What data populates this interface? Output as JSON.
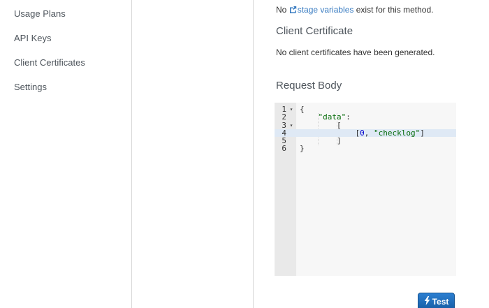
{
  "sidebar": {
    "items": [
      {
        "label": "Usage Plans"
      },
      {
        "label": "API Keys"
      },
      {
        "label": "Client Certificates"
      },
      {
        "label": "Settings"
      }
    ]
  },
  "content": {
    "stage_variables_note": {
      "prefix": "No ",
      "link_text": "stage variables",
      "suffix": " exist for this method.",
      "link_icon": "external-link-icon"
    },
    "client_certificate": {
      "heading": "Client Certificate",
      "empty_text": "No client certificates have been generated."
    },
    "request_body": {
      "heading": "Request Body"
    },
    "editor": {
      "active_line": 4,
      "lines": [
        {
          "number": 1,
          "fold": true,
          "segments": [
            {
              "t": "{",
              "c": "punct"
            }
          ]
        },
        {
          "number": 2,
          "fold": false,
          "segments": [
            {
              "t": "    ",
              "c": "punct"
            },
            {
              "t": "\"data\"",
              "c": "string"
            },
            {
              "t": ":",
              "c": "punct"
            }
          ]
        },
        {
          "number": 3,
          "fold": true,
          "segments": [
            {
              "t": "        ",
              "c": "punct"
            },
            {
              "t": "[",
              "c": "punct"
            }
          ]
        },
        {
          "number": 4,
          "fold": false,
          "segments": [
            {
              "t": "            ",
              "c": "punct"
            },
            {
              "t": "[",
              "c": "punct"
            },
            {
              "t": "0",
              "c": "number"
            },
            {
              "t": ", ",
              "c": "punct"
            },
            {
              "t": "\"checklog\"",
              "c": "string"
            },
            {
              "t": "]",
              "c": "punct"
            }
          ]
        },
        {
          "number": 5,
          "fold": false,
          "segments": [
            {
              "t": "        ",
              "c": "punct"
            },
            {
              "t": "]",
              "c": "punct"
            }
          ]
        },
        {
          "number": 6,
          "fold": false,
          "segments": [
            {
              "t": "}",
              "c": "punct"
            }
          ]
        }
      ]
    },
    "test_button": {
      "label": "Test",
      "icon": "lightning-bolt-icon"
    }
  },
  "colors": {
    "link_blue": "#3579c0",
    "heading_gray": "#4e555c",
    "body_text": "#333333",
    "divider": "#d9d9d9",
    "editor_bg": "#f7f7f7",
    "gutter_bg": "#e9e9e9",
    "active_line_bg": "#dfe9f5",
    "syntax_string": "#036a07",
    "syntax_number": "#0000cd",
    "syntax_punct": "#333333",
    "button_blue_top": "#2c7fd1",
    "button_blue_bottom": "#175ca3"
  }
}
